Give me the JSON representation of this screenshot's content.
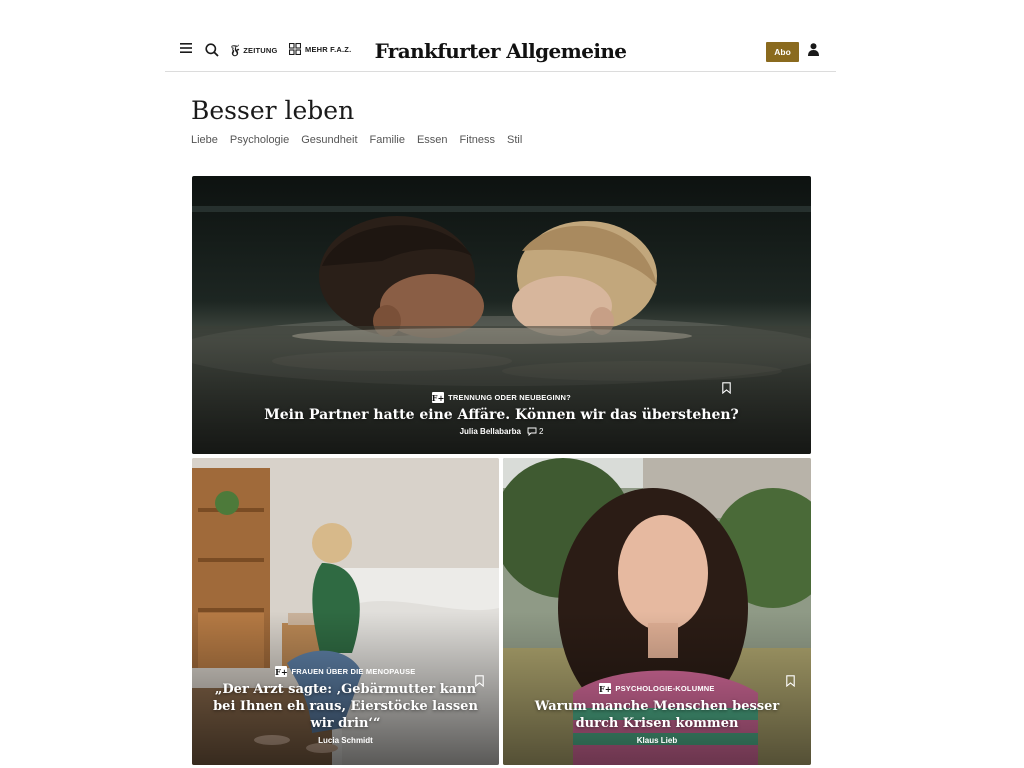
{
  "header": {
    "zeitung_label": "ZEITUNG",
    "mehr_label": "MEHR F.A.Z.",
    "logo_text": "Frankfurter Allgemeine",
    "abo_label": "Abo"
  },
  "section": {
    "title": "Besser leben",
    "subnav": [
      "Liebe",
      "Psychologie",
      "Gesundheit",
      "Familie",
      "Essen",
      "Fitness",
      "Stil"
    ]
  },
  "articles": [
    {
      "kicker": "TRENNUNG ODER NEUBEGINN?",
      "headline": "Mein Partner hatte eine Affäre. Können wir das überstehen?",
      "author": "Julia Bellabarba",
      "comments": "2"
    },
    {
      "kicker": "FRAUEN ÜBER DIE MENOPAUSE",
      "headline": "„Der Arzt sagte: ‚Gebärmutter kann bei Ihnen eh raus, Eierstöcke lassen wir drin‘“",
      "author": "Lucia Schmidt"
    },
    {
      "kicker": "PSYCHOLOGIE-KOLUMNE",
      "headline": "Warum manche Menschen besser durch Krisen kommen",
      "author": "Klaus Lieb"
    }
  ],
  "icons": {
    "menu": "hamburger-icon",
    "search": "search-icon",
    "zeitung": "faz-f-icon",
    "mehr": "grid-icon",
    "account": "user-icon",
    "bookmark": "bookmark-icon",
    "comment": "comment-icon",
    "premium": "f-plus-icon"
  },
  "colors": {
    "abo_button": "#8a6a1e",
    "text": "#1a1a1a",
    "subnav_text": "#555555"
  }
}
